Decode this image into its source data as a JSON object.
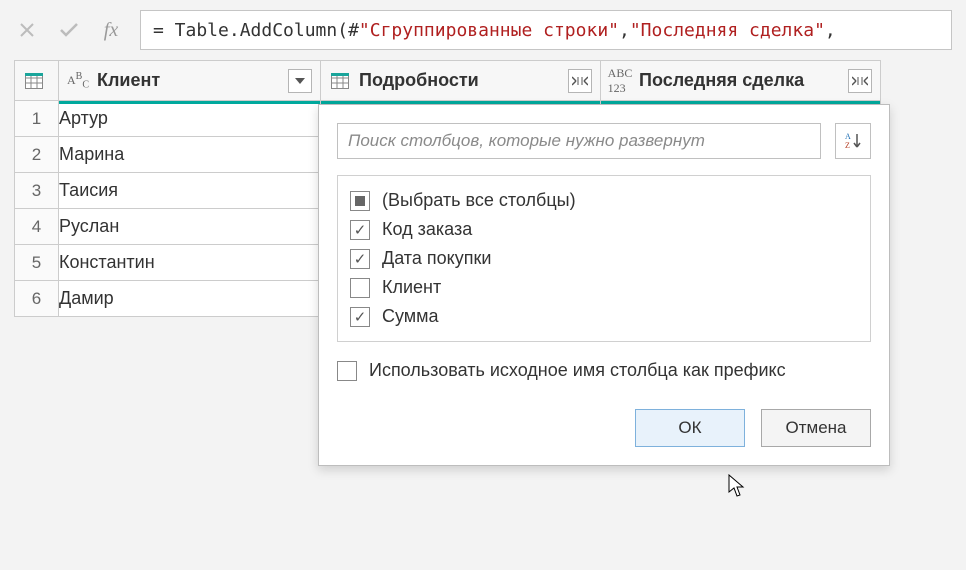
{
  "formula": {
    "prefix": "= Table.AddColumn(#",
    "arg1": "\"Сгруппированные строки\"",
    "sep": ", ",
    "arg2": "\"Последняя сделка\"",
    "suffix": ","
  },
  "columns": {
    "client": "Клиент",
    "details": "Подробности",
    "last": "Последняя сделка"
  },
  "rows": [
    {
      "n": "1",
      "client": "Артур"
    },
    {
      "n": "2",
      "client": "Марина"
    },
    {
      "n": "3",
      "client": "Таисия"
    },
    {
      "n": "4",
      "client": "Руслан"
    },
    {
      "n": "5",
      "client": "Константин"
    },
    {
      "n": "6",
      "client": "Дамир"
    }
  ],
  "popup": {
    "search_placeholder": "Поиск столбцов, которые нужно развернут",
    "select_all": "(Выбрать все столбцы)",
    "items": [
      {
        "label": "Код заказа",
        "checked": true
      },
      {
        "label": "Дата покупки",
        "checked": true
      },
      {
        "label": "Клиент",
        "checked": false
      },
      {
        "label": "Сумма",
        "checked": true
      }
    ],
    "prefix_label": "Использовать исходное имя столбца как префикс",
    "ok": "ОК",
    "cancel": "Отмена"
  }
}
